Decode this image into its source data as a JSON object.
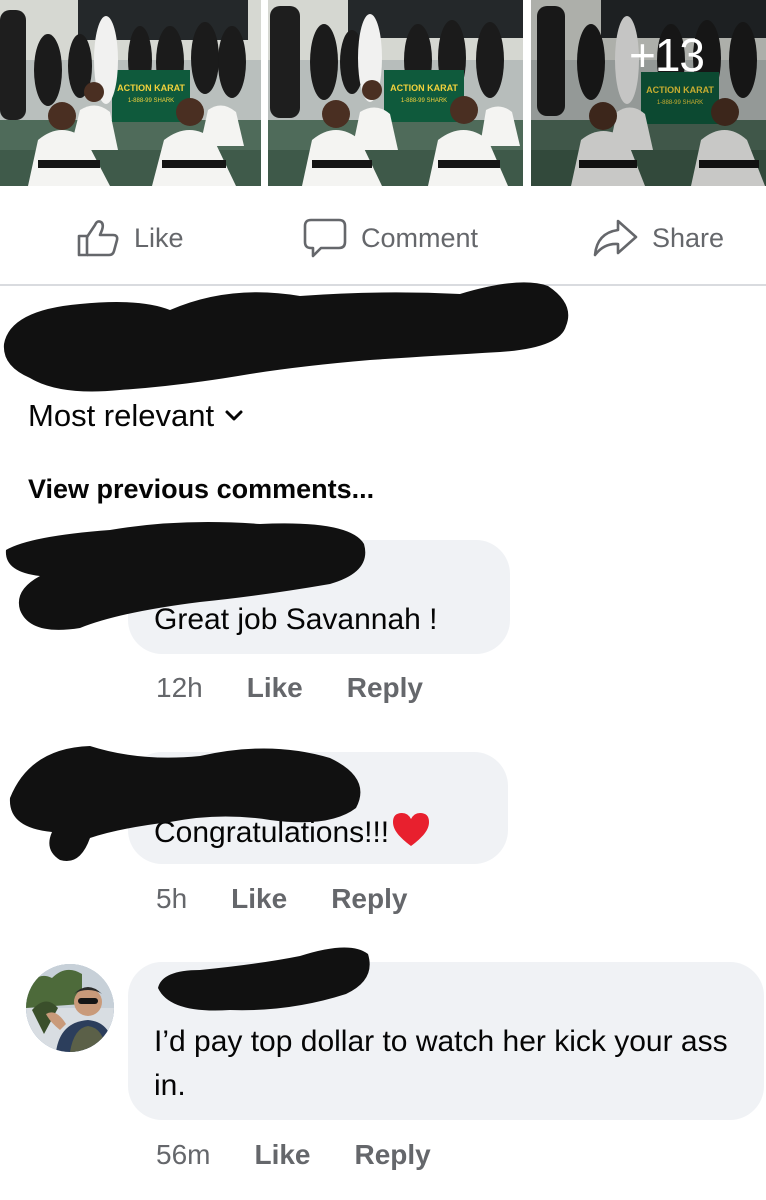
{
  "post": {
    "photos": [
      {
        "icon": "photo-karate-ceremony-1"
      },
      {
        "icon": "photo-karate-ceremony-2"
      },
      {
        "icon": "photo-karate-ceremony-3"
      }
    ],
    "banner_title": "ACTION KARAT",
    "banner_phone": "1-888-99 SHARK",
    "more_photos_label": "+13"
  },
  "actions": {
    "like_label": "Like",
    "comment_label": "Comment",
    "share_label": "Share",
    "color": "#65676b"
  },
  "comments_section": {
    "sort_label": "Most relevant",
    "view_previous_label": "View previous comments..."
  },
  "comments": [
    {
      "text": "Great job Savannah !",
      "time": "12h",
      "like_label": "Like",
      "reply_label": "Reply"
    },
    {
      "text": "Congratulations!!!",
      "emoji": "red-heart",
      "time": "5h",
      "like_label": "Like",
      "reply_label": "Reply"
    },
    {
      "text": "I’d pay top dollar to watch her kick your ass in.",
      "time": "56m",
      "like_label": "Like",
      "reply_label": "Reply"
    }
  ],
  "colors": {
    "bubble_bg": "#f0f2f5",
    "meta_text": "#65676b",
    "divider": "#d9dbdf",
    "redaction": "#111111",
    "banner_green": "#0f5a3c"
  }
}
